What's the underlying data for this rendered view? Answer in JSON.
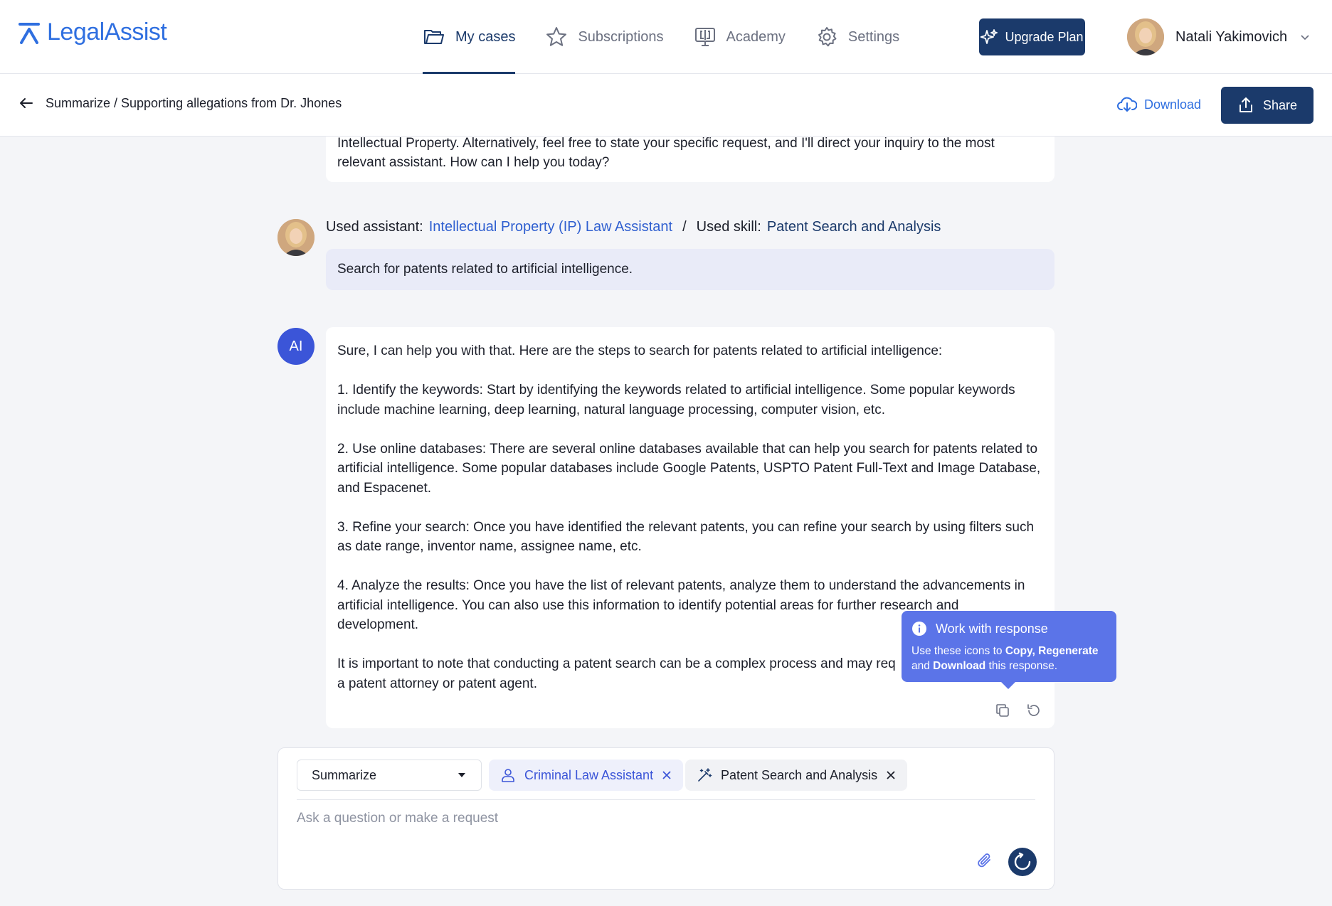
{
  "app": {
    "name": "LegalAssist",
    "accent": "#2f6fe0",
    "primary": "#1b3a6b"
  },
  "nav": {
    "items": [
      {
        "label": "My cases",
        "icon": "folder-icon",
        "active": true
      },
      {
        "label": "Subscriptions",
        "icon": "star-icon",
        "active": false
      },
      {
        "label": "Academy",
        "icon": "academy-icon",
        "active": false
      },
      {
        "label": "Settings",
        "icon": "gear-icon",
        "active": false
      }
    ],
    "upgrade_label": "Upgrade Plan",
    "user_name": "Natali Yakimovich"
  },
  "subheader": {
    "breadcrumb": "Summarize / Supporting allegations from Dr. Jhones",
    "download_label": "Download",
    "share_label": "Share"
  },
  "chat": {
    "previous_text": "Intellectual Property. Alternatively, feel free to state your specific request, and I'll direct your inquiry to the most relevant assistant. How can I help you today?",
    "used_assistant_label": "Used assistant:",
    "used_assistant": "Intellectual Property (IP) Law Assistant",
    "separator": "/",
    "used_skill_label": "Used skill:",
    "used_skill": "Patent Search and Analysis",
    "user_message": "Search for patents related to artificial intelligence.",
    "ai_avatar_label": "AI",
    "ai_paragraphs": [
      "Sure, I can help you with that. Here are the steps to search for patents related to artificial intelligence:",
      "1. Identify the keywords: Start by identifying the keywords related to artificial intelligence. Some popular keywords include machine learning, deep learning, natural language processing, computer vision, etc.",
      "2. Use online databases: There are several online databases available that can help you search for patents related to artificial intelligence. Some popular databases include Google Patents, USPTO Patent Full-Text and Image Database, and Espacenet.",
      "3. Refine your search: Once you have identified the relevant patents, you can refine your search by using filters such as date range, inventor name, assignee name, etc.",
      "4. Analyze the results: Once you have the list of relevant patents, analyze them to understand the advancements in artificial intelligence. You can also use this information to identify potential areas for further research and development.",
      "It is important to note that conducting a patent search can be a complex process and may req",
      "a patent attorney or patent agent."
    ]
  },
  "tooltip": {
    "title": "Work with response",
    "body_prefix": "Use these icons to ",
    "copy": "Copy",
    "comma": ", ",
    "regenerate": "Regenerate",
    "and1": " and ",
    "download": "Download",
    "suffix": " this response."
  },
  "composer": {
    "mode": "Summarize",
    "assistant_chip": "Criminal Law Assistant",
    "skill_chip": "Patent Search and Analysis",
    "placeholder": "Ask a question or make a request"
  }
}
